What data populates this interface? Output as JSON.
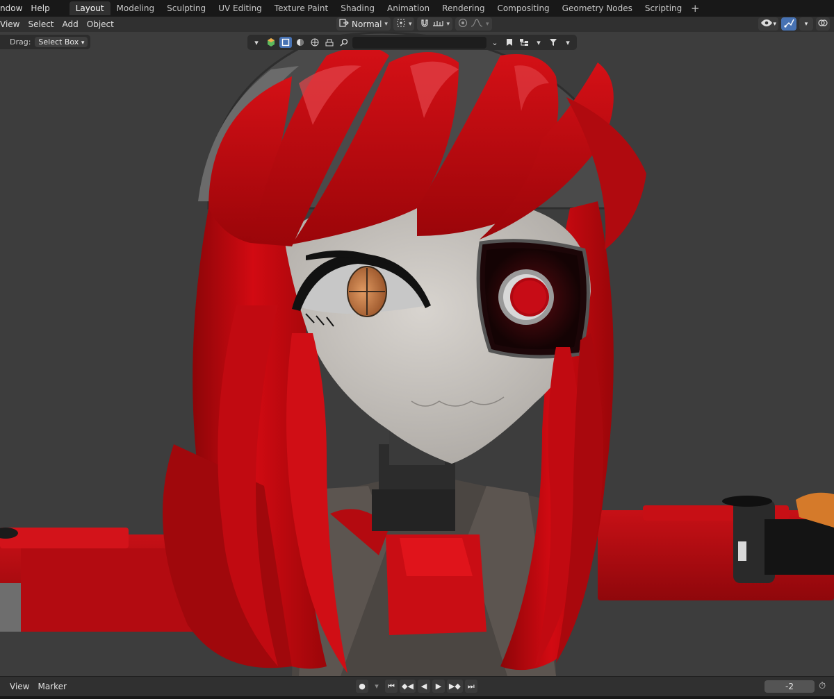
{
  "menu": {
    "items": [
      "ndow",
      "Help"
    ]
  },
  "workspaces": {
    "tabs": [
      "Layout",
      "Modeling",
      "Sculpting",
      "UV Editing",
      "Texture Paint",
      "Shading",
      "Animation",
      "Rendering",
      "Compositing",
      "Geometry Nodes",
      "Scripting"
    ],
    "active": "Layout",
    "add_symbol": "+"
  },
  "viewport_header": {
    "menus": [
      "View",
      "Select",
      "Add",
      "Object"
    ],
    "transform_orientation": "Normal"
  },
  "tool_settings": {
    "drag_label": "Drag:",
    "drag_value": "Select Box"
  },
  "outliner": {
    "search_value": ""
  },
  "timeline": {
    "menus": [
      "View",
      "Marker"
    ],
    "current_frame": "-2"
  },
  "colors": {
    "accent": "#4772b3",
    "viewport_bg": "#3d3d3d",
    "hair_red": "#c4060d",
    "skin": "#c9c5c0",
    "iris": "#b86b3c"
  },
  "icons": [
    "chevron-down-icon",
    "transform-pivot-icon",
    "snap-magnet-icon",
    "proportional-edit-icon",
    "falloff-icon",
    "visibility-eye-icon",
    "gizmo-icon",
    "overlay-icon",
    "cube-icon",
    "sphere-icon",
    "search-icon",
    "filter-icon",
    "record-icon",
    "play-icon",
    "stopwatch-icon"
  ]
}
